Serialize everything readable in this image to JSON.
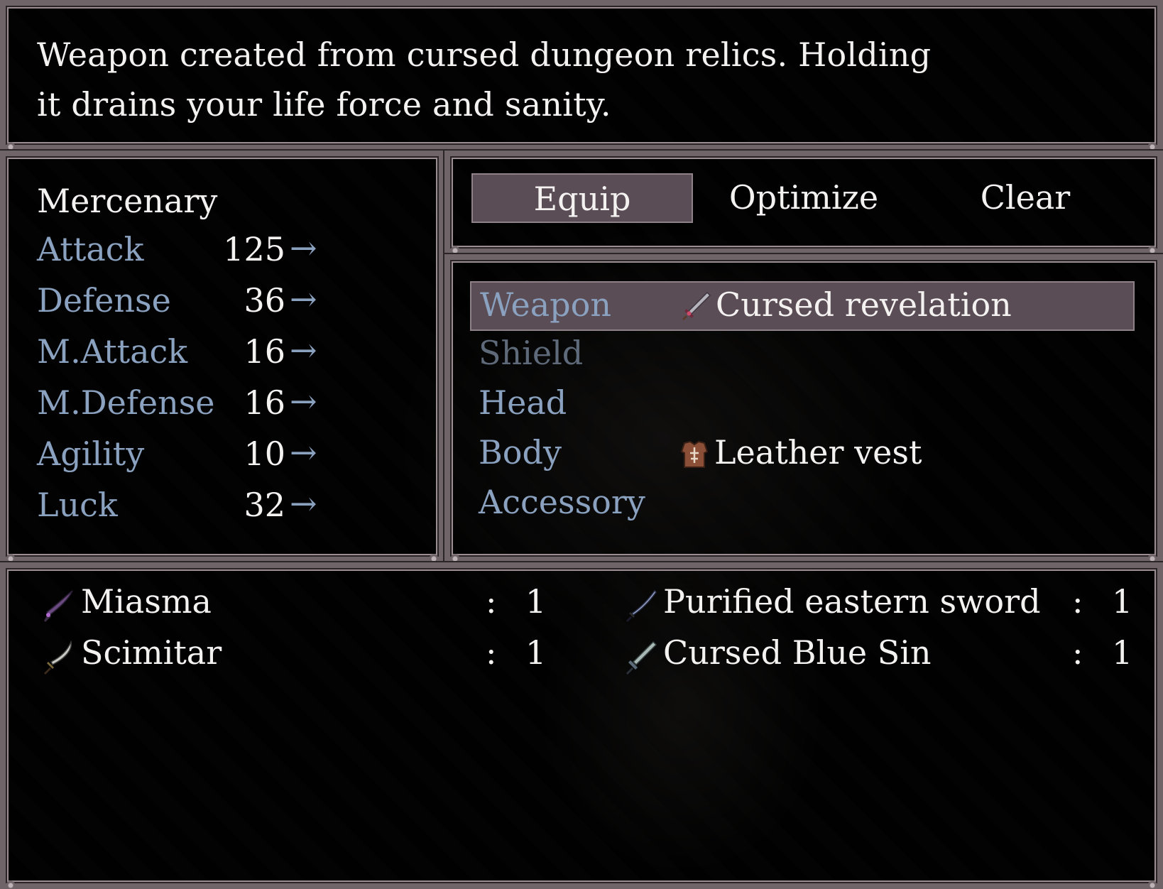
{
  "help": {
    "line1": "Weapon created from cursed dungeon relics. Holding",
    "line2": "it drains your life force and sanity."
  },
  "status": {
    "actor_name": "Mercenary",
    "arrow": "→",
    "stats": [
      {
        "label": "Attack",
        "value": "125"
      },
      {
        "label": "Defense",
        "value": "36"
      },
      {
        "label": "M.Attack",
        "value": "16"
      },
      {
        "label": "M.Defense",
        "value": "16"
      },
      {
        "label": "Agility",
        "value": "10"
      },
      {
        "label": "Luck",
        "value": "32"
      }
    ]
  },
  "commands": {
    "equip": "Equip",
    "optimize": "Optimize",
    "clear": "Clear",
    "selected": "Equip"
  },
  "slots": [
    {
      "label": "Weapon",
      "item": "Cursed revelation",
      "icon": "sword-icon",
      "selected": true
    },
    {
      "label": "Shield",
      "item": "",
      "icon": "",
      "disabled": true
    },
    {
      "label": "Head",
      "item": "",
      "icon": ""
    },
    {
      "label": "Body",
      "item": "Leather vest",
      "icon": "armor-vest-icon"
    },
    {
      "label": "Accessory",
      "item": "",
      "icon": ""
    }
  ],
  "inventory": {
    "separator": ":",
    "items": [
      {
        "name": "Miasma",
        "count": "1",
        "icon": "dark-scythe-sword-icon"
      },
      {
        "name": "Purified eastern sword",
        "count": "1",
        "icon": "katana-icon"
      },
      {
        "name": "Scimitar",
        "count": "1",
        "icon": "scimitar-icon"
      },
      {
        "name": "Cursed Blue Sin",
        "count": "1",
        "icon": "blue-sword-icon"
      }
    ]
  },
  "colors": {
    "system_label": "#8aa1bf",
    "normal_text": "#f4f1f1",
    "selection_fill": "#5b4d55",
    "frame": "#6f6468"
  }
}
